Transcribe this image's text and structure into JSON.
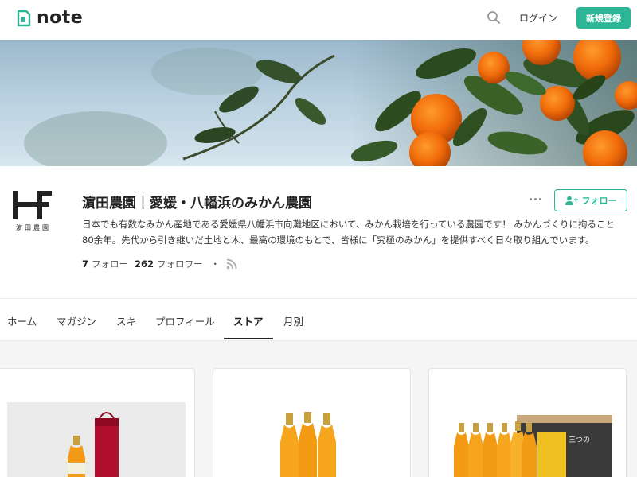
{
  "header": {
    "logo_text": "note",
    "login_label": "ログイン",
    "signup_label": "新規登録"
  },
  "profile": {
    "avatar_caption": "濵田農園",
    "name": "濵田農園｜愛媛・八幡浜のみかん農園",
    "description": "日本でも有数なみかん産地である愛媛県八幡浜市向灘地区において、みかん栽培を行っている農園です！ みかんづくりに拘ること80余年。先代から引き継いだ土地と木、最高の環境のもとで、皆様に「究極のみかん」を提供すべく日々取り組んでいます。",
    "follow_label": "フォロー",
    "following_count": "7",
    "following_label": "フォロー",
    "follower_count": "262",
    "follower_label": "フォロワー",
    "dot": "・"
  },
  "tabs": [
    {
      "label": "ホーム"
    },
    {
      "label": "マガジン"
    },
    {
      "label": "スキ"
    },
    {
      "label": "プロフィール"
    },
    {
      "label": "ストア"
    },
    {
      "label": "月別"
    }
  ],
  "active_tab": "ストア",
  "colors": {
    "accent": "#2cb696",
    "text": "#222222",
    "background_store": "#f5f5f5"
  },
  "icons": {
    "search": "search-icon",
    "more": "more-dots-icon",
    "follow": "person-add-icon",
    "rss": "rss-icon"
  }
}
